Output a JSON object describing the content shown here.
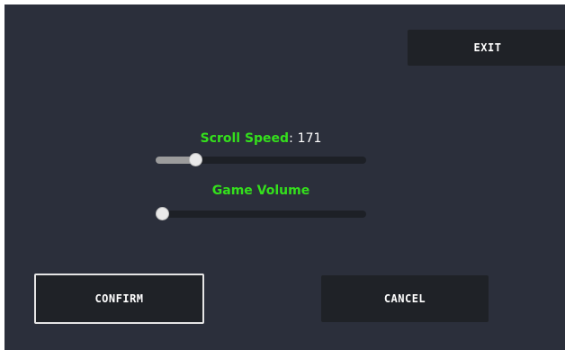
{
  "menu": {
    "exit_label": "EXIT",
    "confirm_label": "CONFIRM",
    "cancel_label": "CANCEL"
  },
  "settings": {
    "scroll_speed": {
      "label": "Scroll Speed",
      "separator": ":",
      "value": "171",
      "fraction": 0.19
    },
    "game_volume": {
      "label": "Game Volume",
      "fraction": 0.03
    }
  },
  "colors": {
    "background": "#2b2f3b",
    "button": "#1f2227",
    "label_green": "#34e01c",
    "track": "#1d2026",
    "fill": "#9c9c9c"
  }
}
